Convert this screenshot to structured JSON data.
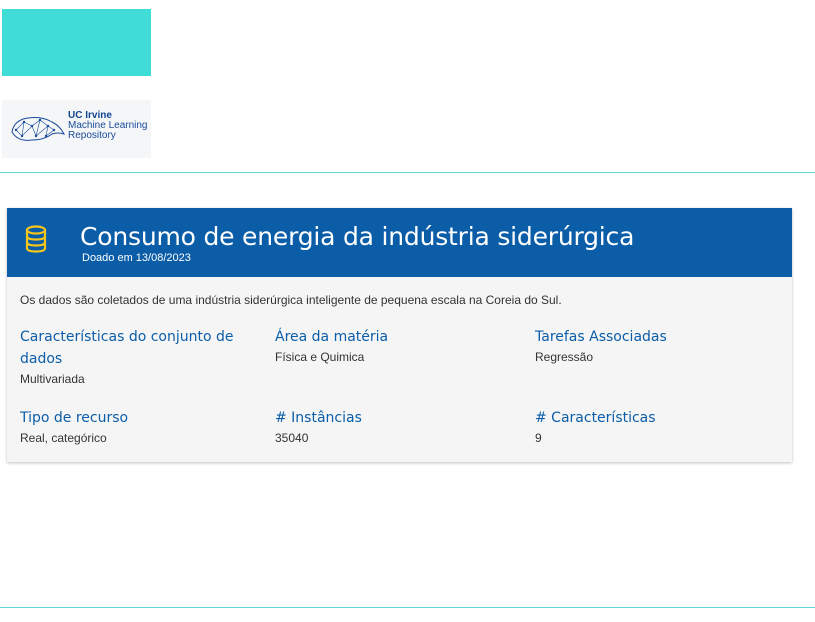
{
  "logo": {
    "line1": "UC Irvine",
    "line2": "Machine Learning",
    "line3": "Repository",
    "icon": "anteater-network-icon"
  },
  "dataset": {
    "title": "Consumo de energia da indústria siderúrgica",
    "donated": "Doado em 13/08/2023",
    "icon": "database-icon",
    "description": "Os dados são coletados de uma indústria siderúrgica inteligente de pequena escala na Coreia do Sul."
  },
  "fields": [
    {
      "label_line1": "Características do conjunto de",
      "label_line2": "dados",
      "value": "Multivariada"
    },
    {
      "label": "Área da matéria",
      "value": "Física e Quimica"
    },
    {
      "label": "Tarefas Associadas",
      "value": "Regressão"
    },
    {
      "label": "Tipo de recurso",
      "value": "Real, categórico"
    },
    {
      "label": "# Instâncias",
      "value": "35040"
    },
    {
      "label": "# Características",
      "value": "9"
    }
  ],
  "colors": {
    "header": "#0b5da8",
    "accent_teal": "#40dcd8",
    "icon_yellow": "#f5c518"
  }
}
